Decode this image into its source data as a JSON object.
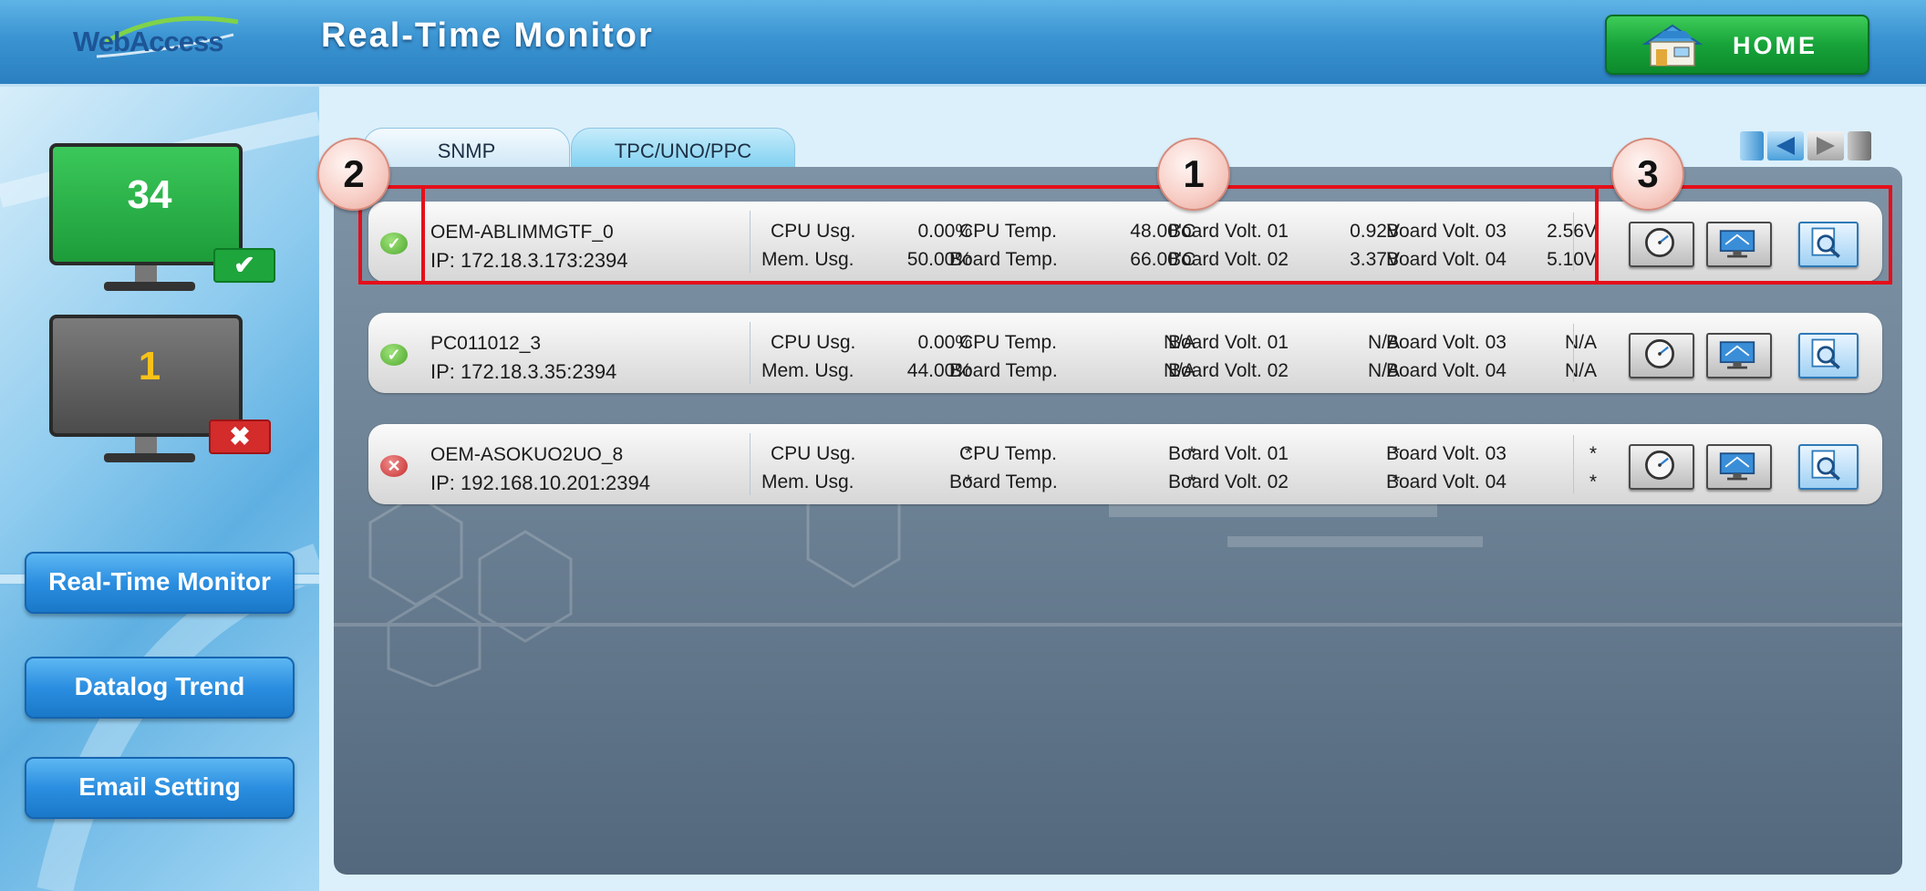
{
  "header": {
    "logo_text": "WebAccess",
    "title": "Real-Time Monitor",
    "home_label": "HOME"
  },
  "sidebar": {
    "online_count": "34",
    "offline_count": "1",
    "buttons": [
      "Real-Time Monitor",
      "Datalog Trend",
      "Email Setting"
    ]
  },
  "tabs": [
    {
      "label": "SNMP",
      "active": false
    },
    {
      "label": "TPC/UNO/PPC",
      "active": true
    }
  ],
  "field_labels": {
    "cpu_usage": "CPU Usg.",
    "mem_usage": "Mem. Usg.",
    "cpu_temp": "CPU Temp.",
    "board_temp": "Board Temp.",
    "volt1": "Board Volt. 01",
    "volt2": "Board Volt. 02",
    "volt3": "Board Volt. 03",
    "volt4": "Board Volt. 04"
  },
  "devices": [
    {
      "status": "online",
      "name": "OEM-ABLIMMGTF_0",
      "ip": "IP: 172.18.3.173:2394",
      "cpu_usage": "0.00%",
      "mem_usage": "50.00%",
      "cpu_temp": "48.00'C",
      "board_temp": "66.00'C",
      "volt1": "0.92V",
      "volt2": "3.37V",
      "volt3": "2.56V",
      "volt4": "5.10V"
    },
    {
      "status": "online",
      "name": "PC011012_3",
      "ip": "IP: 172.18.3.35:2394",
      "cpu_usage": "0.00%",
      "mem_usage": "44.00%",
      "cpu_temp": "N/A",
      "board_temp": "N/A",
      "volt1": "N/A",
      "volt2": "N/A",
      "volt3": "N/A",
      "volt4": "N/A"
    },
    {
      "status": "offline",
      "name": "OEM-ASOKUO2UO_8",
      "ip": "IP: 192.168.10.201:2394",
      "cpu_usage": "*",
      "mem_usage": "*",
      "cpu_temp": "*",
      "board_temp": "*",
      "volt1": "*",
      "volt2": "*",
      "volt3": "*",
      "volt4": "*"
    }
  ],
  "callouts": [
    "1",
    "2",
    "3"
  ],
  "colors": {
    "header_blue": "#3b94d2",
    "home_green": "#17a33a",
    "highlight_red": "#e40f1a",
    "status_ok": "#4ea82d",
    "status_offline": "#c52e2e"
  },
  "icons": {
    "online_badge": "check-icon",
    "offline_badge": "x-icon",
    "row_action_1": "gauge-icon",
    "row_action_2": "remote-desktop-icon",
    "row_action_3": "magnifier-icon"
  }
}
